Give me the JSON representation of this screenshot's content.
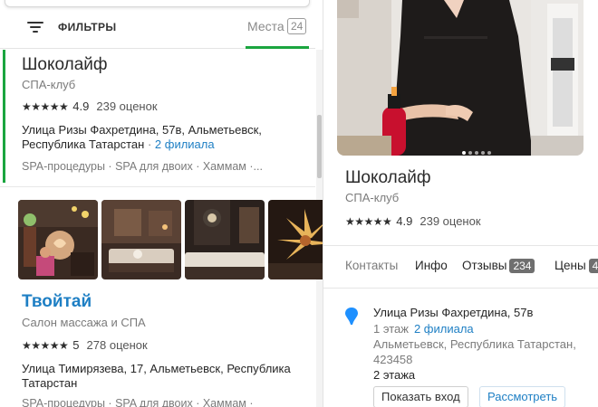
{
  "list_header": {
    "filters_label": "ФИЛЬТРЫ",
    "places_label": "Места",
    "places_count": "24"
  },
  "results": [
    {
      "name": "Шоколайф",
      "type": "СПА-клуб",
      "stars": "★★★★★",
      "rating": "4.9",
      "reviews": "239 оценок",
      "address": "Улица Ризы Фахретдина, 57в, Альметьевск, Республика Татарстан",
      "branches": "2 филиала",
      "categories": "SPA-процедуры · SPA для двоих · Хаммам ·..."
    },
    {
      "name": "Твойтай",
      "type": "Салон массажа и СПА",
      "stars": "★★★★★",
      "rating": "5",
      "reviews": "278 оценок",
      "address": "Улица Тимирязева, 17, Альметьевск, Республика Татарстан",
      "categories": "SPA-процедуры · SPA для двоих · Хаммам ·"
    }
  ],
  "details": {
    "name": "Шоколайф",
    "type": "СПА-клуб",
    "stars": "★★★★★",
    "rating": "4.9",
    "reviews": "239 оценок",
    "tabs": [
      {
        "label": "Контакты"
      },
      {
        "label": "Инфо"
      },
      {
        "label": "Отзывы",
        "badge": "234"
      },
      {
        "label": "Цены",
        "badge": "4"
      }
    ],
    "contact": {
      "street": "Улица Ризы Фахретдина, 57в",
      "floor": "1 этаж",
      "branches": "2 филиала",
      "city": "Альметьевск, Республика Татарстан,",
      "postcode": "423458",
      "floor2": "2 этажа",
      "show_entrance_label": "Показать вход",
      "view_label": "Рассмотреть"
    }
  },
  "colors": {
    "accent_green": "#1aa53f",
    "link_blue": "#1e7fc4"
  }
}
